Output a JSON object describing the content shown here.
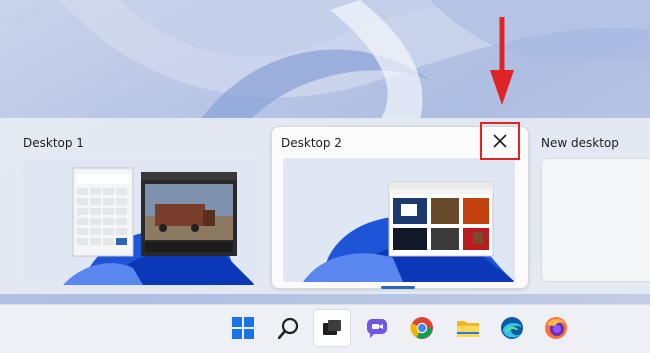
{
  "wallpaper": {
    "color": "#b9c6e3",
    "accent": "#3a5fc9"
  },
  "desktops": [
    {
      "label": "Desktop 1"
    },
    {
      "label": "Desktop 2"
    },
    {
      "label": "New desktop"
    }
  ],
  "close_button": {
    "icon": "close-icon",
    "highlight_color": "#e02424"
  },
  "annotation": {
    "arrow_color": "#e02424"
  },
  "accent_color": "#2f65b7",
  "taskbar": {
    "icons": [
      {
        "name": "start-icon"
      },
      {
        "name": "search-icon"
      },
      {
        "name": "task-view-icon"
      },
      {
        "name": "chat-icon"
      },
      {
        "name": "chrome-icon"
      },
      {
        "name": "file-explorer-icon"
      },
      {
        "name": "edge-icon"
      },
      {
        "name": "firefox-icon"
      }
    ]
  }
}
